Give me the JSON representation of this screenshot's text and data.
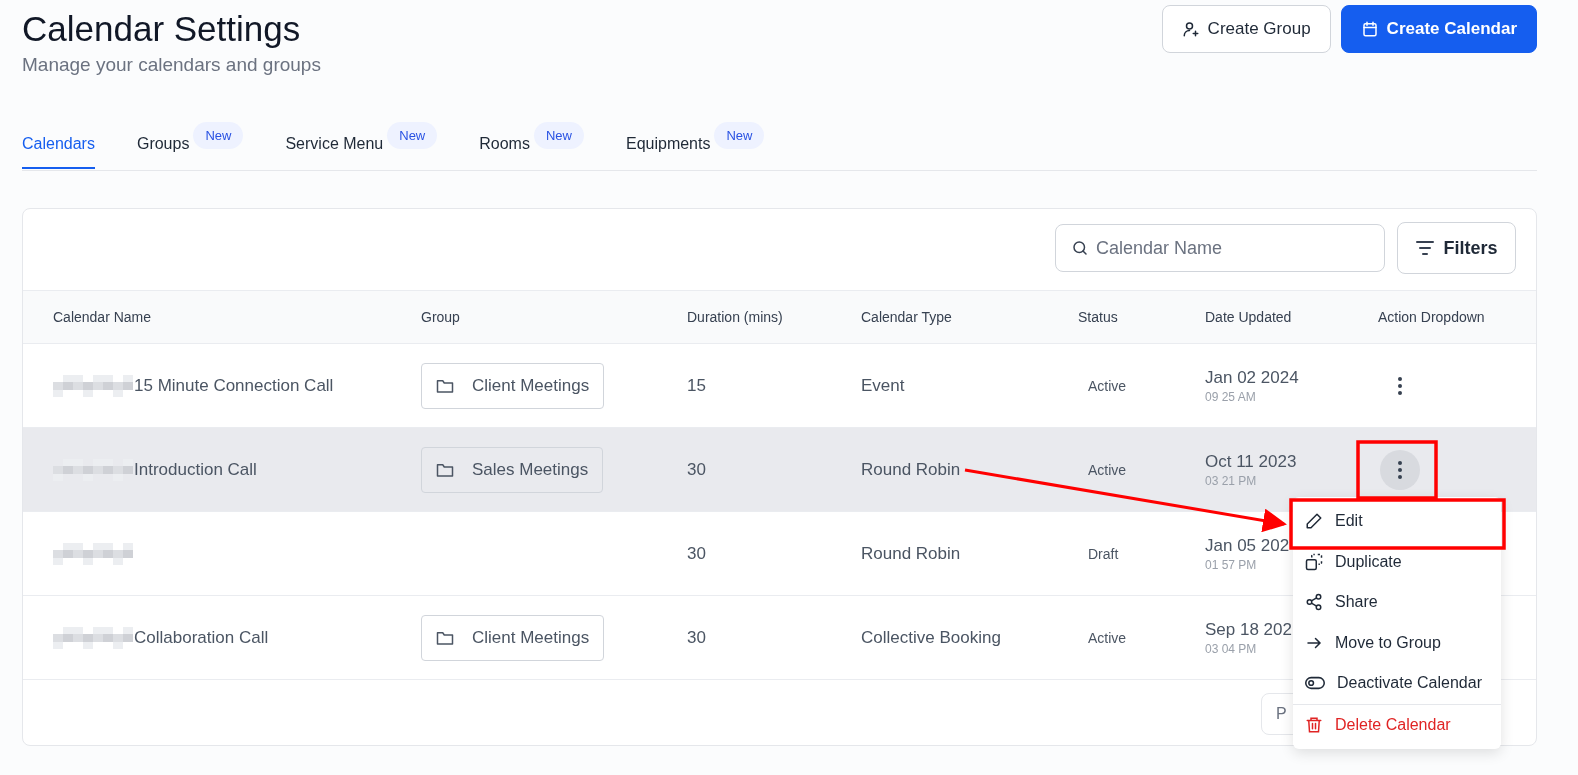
{
  "header": {
    "title": "Calendar Settings",
    "subtitle": "Manage your calendars and groups"
  },
  "actions": [
    {
      "label": "Create Group",
      "kind": "secondary"
    },
    {
      "label": "Create Calendar",
      "kind": "primary"
    }
  ],
  "tabs": [
    {
      "label": "Calendars",
      "selected": true
    },
    {
      "label": "Groups",
      "badge": "New",
      "selected": false
    },
    {
      "label": "Service Menu",
      "badge": "New",
      "selected": false
    },
    {
      "label": "Rooms",
      "badge": "New",
      "selected": false
    },
    {
      "label": "Equipments",
      "badge": "New",
      "selected": false
    }
  ],
  "search": {
    "placeholder": "Calendar Name"
  },
  "filters_button": "Filters",
  "table": {
    "columns": [
      "Calendar Name",
      "Group",
      "Duration (mins)",
      "Calendar Type",
      "Status",
      "Date Updated",
      "Action Dropdown"
    ],
    "rows": [
      {
        "name": "15 Minute Connection Call",
        "group": "Client Meetings",
        "duration": "15",
        "type": "Event",
        "status": "Active",
        "date": "Jan 02 2024",
        "time": "09 25 AM",
        "highlighted": false,
        "menu_open": false
      },
      {
        "name": "Introduction Call",
        "group": "Sales Meetings",
        "duration": "30",
        "type": "Round Robin",
        "status": "Active",
        "date": "Oct 11 2023",
        "time": "03 21 PM",
        "highlighted": true,
        "menu_open": true
      },
      {
        "duration": "30",
        "type": "Round Robin",
        "status": "Draft",
        "date": "Jan 05 202",
        "time": "01 57 PM",
        "highlighted": false
      },
      {
        "name": "Collaboration Call",
        "group": "Client Meetings",
        "duration": "30",
        "type": "Collective Booking",
        "status": "Active",
        "date": "Sep 18 202",
        "time": "03 04 PM",
        "highlighted": false
      }
    ]
  },
  "action_menu": {
    "items": [
      {
        "label": "Edit",
        "danger": false
      },
      {
        "label": "Duplicate",
        "danger": false
      },
      {
        "label": "Share",
        "danger": false
      },
      {
        "label": "Move to Group",
        "danger": false
      },
      {
        "label": "Deactivate Calendar",
        "danger": false
      },
      {
        "label": "Delete Calendar",
        "danger": true
      }
    ]
  },
  "pagination": {
    "button": "P"
  }
}
